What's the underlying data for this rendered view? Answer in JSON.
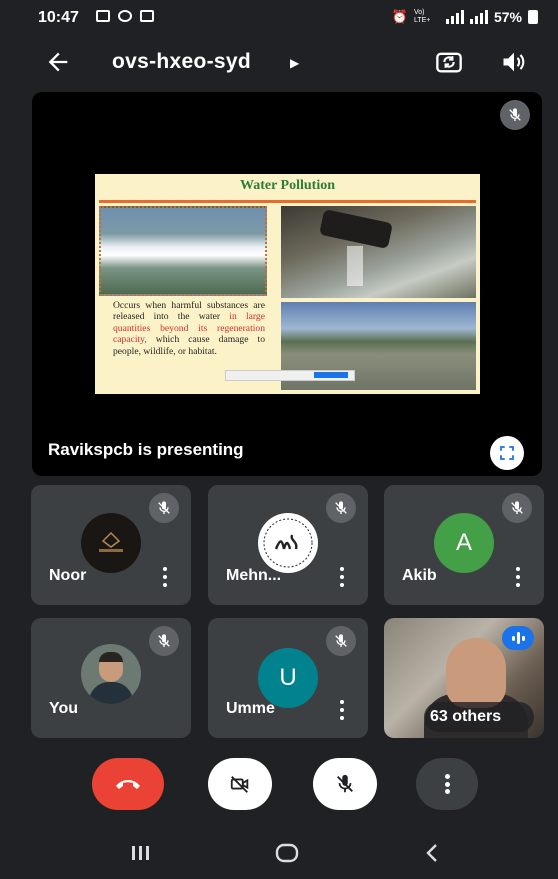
{
  "status_bar": {
    "time": "10:47",
    "network_label": "Vo) LTE+",
    "battery": "57%"
  },
  "header": {
    "meeting_code": "ovs-hxeo-syd"
  },
  "presentation": {
    "slide": {
      "title": "Water Pollution",
      "text_before": "Occurs when harmful substances are released into the water ",
      "text_highlight": "in large quantities beyond its regeneration capacity,",
      "text_after": " which cause damage to people, wildlife, or habitat."
    },
    "presenting_label": "Ravikspcb is presenting"
  },
  "participants": [
    {
      "name": "Noor",
      "avatar_type": "logo",
      "muted": true
    },
    {
      "name": "Mehn...",
      "avatar_type": "logo",
      "muted": true
    },
    {
      "name": "Akib",
      "avatar_letter": "A",
      "avatar_color": "#43a047",
      "muted": true
    },
    {
      "name": "You",
      "avatar_type": "photo",
      "muted": true
    },
    {
      "name": "Umme",
      "avatar_letter": "U",
      "avatar_color": "#00838f",
      "muted": true
    }
  ],
  "others": {
    "label": "63 others"
  },
  "colors": {
    "background": "#202124",
    "tile": "#3c4043",
    "end_call": "#ea4335",
    "accent_blue": "#1a73e8"
  }
}
